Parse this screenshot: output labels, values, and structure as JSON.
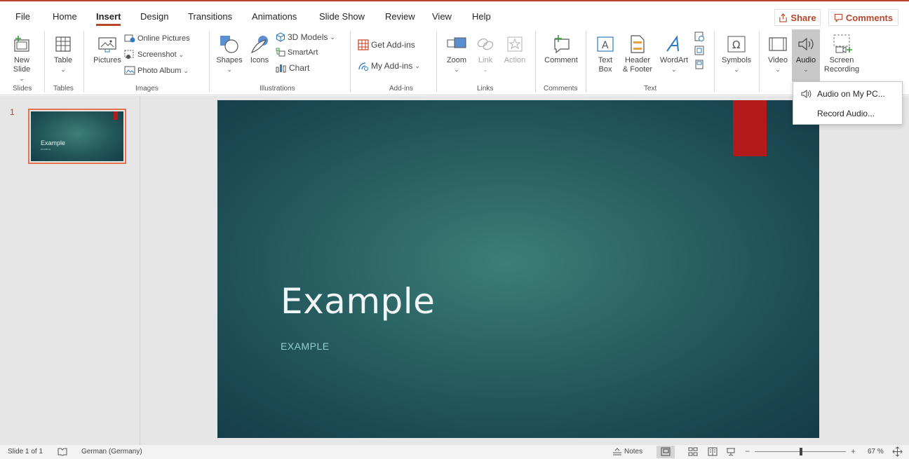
{
  "tabs": [
    "File",
    "Home",
    "Insert",
    "Design",
    "Transitions",
    "Animations",
    "Slide Show",
    "Review",
    "View",
    "Help"
  ],
  "active_tab": "Insert",
  "share_label": "Share",
  "comments_label": "Comments",
  "ribbon": {
    "slides": {
      "new_slide": "New",
      "new_slide2": "Slide",
      "group": "Slides"
    },
    "tables": {
      "table": "Table",
      "group": "Tables"
    },
    "images": {
      "pictures": "Pictures",
      "online_pictures": "Online Pictures",
      "screenshot": "Screenshot",
      "photo_album": "Photo Album",
      "group": "Images"
    },
    "illustrations": {
      "shapes": "Shapes",
      "icons": "Icons",
      "models": "3D Models",
      "smartart": "SmartArt",
      "chart": "Chart",
      "group": "Illustrations"
    },
    "addins": {
      "get": "Get Add-ins",
      "my": "My Add-ins",
      "group": "Add-ins"
    },
    "links": {
      "zoom": "Zoom",
      "link": "Link",
      "action": "Action",
      "group": "Links"
    },
    "comments": {
      "comment": "Comment",
      "group": "Comments"
    },
    "text": {
      "textbox1": "Text",
      "textbox2": "Box",
      "header1": "Header",
      "header2": "& Footer",
      "wordart": "WordArt",
      "group": "Text"
    },
    "symbols": {
      "symbols": "Symbols"
    },
    "media": {
      "video": "Video",
      "audio": "Audio",
      "screen1": "Screen",
      "screen2": "Recording"
    }
  },
  "audio_menu": {
    "audio_on_pc": "Audio on My PC...",
    "record_audio": "Record Audio..."
  },
  "thumbnail": {
    "number": "1",
    "title": "Example",
    "subtitle": "EXAMPLE"
  },
  "slide": {
    "title": "Example",
    "subtitle": "EXAMPLE"
  },
  "status": {
    "slide_of": "Slide 1 of 1",
    "language": "German (Germany)",
    "notes": "Notes",
    "zoom": "67 %"
  },
  "colors": {
    "accent": "#b7472a",
    "slide_bg": "#2b6565",
    "slide_red": "#b31b1b"
  }
}
